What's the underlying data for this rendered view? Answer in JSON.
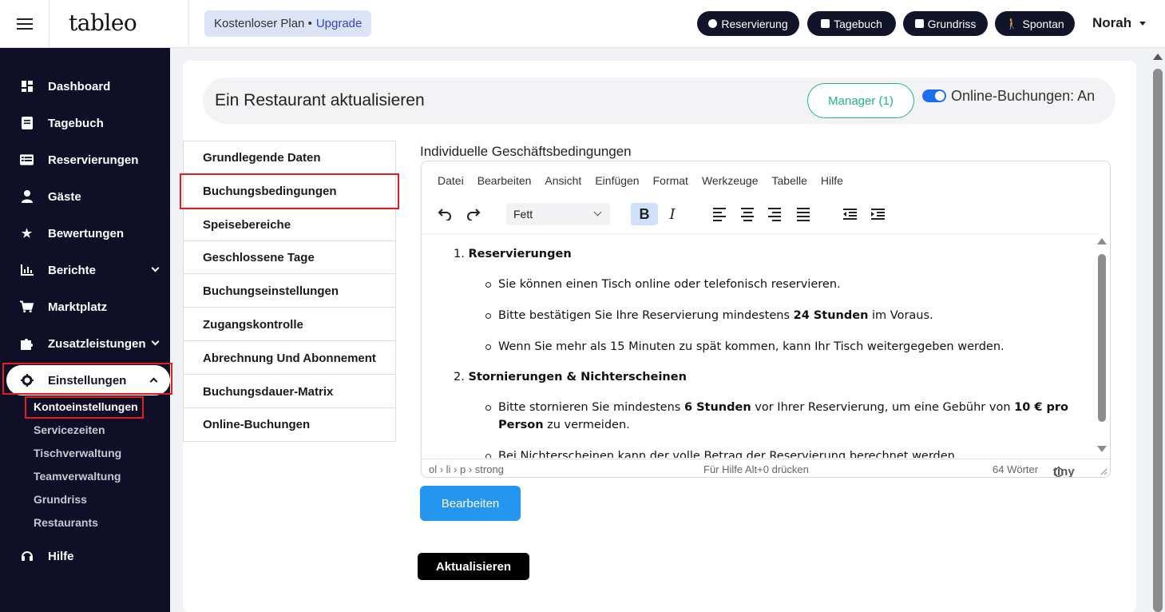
{
  "app": {
    "logo": "tableo",
    "plan_text": "Kostenloser Plan •",
    "plan_upgrade": "Upgrade",
    "user": "Norah"
  },
  "top_buttons": [
    {
      "label": "Reservierung",
      "icon": "plus-circle-icon"
    },
    {
      "label": "Tagebuch",
      "icon": "calendar-icon"
    },
    {
      "label": "Grundriss",
      "icon": "calendar-icon"
    },
    {
      "label": "Spontan",
      "icon": "walking-icon"
    }
  ],
  "sidebar": {
    "items": [
      {
        "label": "Dashboard",
        "icon": "dashboard-icon"
      },
      {
        "label": "Tagebuch",
        "icon": "book-icon"
      },
      {
        "label": "Reservierungen",
        "icon": "list-icon"
      },
      {
        "label": "Gäste",
        "icon": "user-icon"
      },
      {
        "label": "Bewertungen",
        "icon": "star-icon"
      },
      {
        "label": "Berichte",
        "icon": "chart-icon"
      },
      {
        "label": "Marktplatz",
        "icon": "cart-icon"
      },
      {
        "label": "Zusatzleistungen",
        "icon": "puzzle-icon"
      },
      {
        "label": "Einstellungen",
        "icon": "gear-icon"
      },
      {
        "label": "Hilfe",
        "icon": "headset-icon"
      }
    ],
    "sub_items": [
      "Kontoeinstellungen",
      "Servicezeiten",
      "Tischverwaltung",
      "Teamverwaltung",
      "Grundriss",
      "Restaurants"
    ]
  },
  "header": {
    "title": "Ein Restaurant aktualisieren",
    "manager_button": "Manager (1)",
    "online_toggle_label": "Online-Buchungen: An",
    "online_toggle_on": true
  },
  "tabs": [
    "Grundlegende Daten",
    "Buchungsbedingungen",
    "Speisebereiche",
    "Geschlossene Tage",
    "Buchungseinstellungen",
    "Zugangskontrolle",
    "Abrechnung Und Abonnement",
    "Buchungsdauer-Matrix",
    "Online-Buchungen"
  ],
  "editor": {
    "label": "Individuelle Geschäftsbedingungen",
    "menu": [
      "Datei",
      "Bearbeiten",
      "Ansicht",
      "Einfügen",
      "Format",
      "Werkzeuge",
      "Tabelle",
      "Hilfe"
    ],
    "font_select": "Fett",
    "content": {
      "s1_num": "1.",
      "s1_title": "Reservierungen",
      "b1": "Sie können einen Tisch online oder telefonisch reservieren.",
      "b2_pre": "Bitte bestätigen Sie Ihre Reservierung mindestens ",
      "b2_bold": "24 Stunden",
      "b2_post": " im Voraus.",
      "b3": "Wenn Sie mehr als 15 Minuten zu spät kommen, kann Ihr Tisch weitergegeben werden.",
      "s2_num": "2.",
      "s2_title": "Stornierungen & Nichterscheinen",
      "b4_pre": "Bitte stornieren Sie mindestens ",
      "b4_bold1": "6 Stunden",
      "b4_mid": " vor Ihrer Reservierung, um eine Gebühr von ",
      "b4_bold2": "10 € pro",
      "b4_bold3": "Person",
      "b4_post": " zu vermeiden.",
      "b5": "Bei Nichterscheinen kann der volle Betrag der Reservierung berechnet werden."
    },
    "status_path": "ol › li › p › strong",
    "status_help": "Für Hilfe Alt+0 drücken",
    "status_words": "64 Wörter",
    "status_brand": "tiny"
  },
  "buttons": {
    "edit": "Bearbeiten",
    "update": "Aktualisieren"
  },
  "colors": {
    "sidebar_bg": "#0f1028",
    "accent_blue": "#2496f0",
    "manager_green": "#1fb586",
    "highlight_red": "#e02020"
  }
}
